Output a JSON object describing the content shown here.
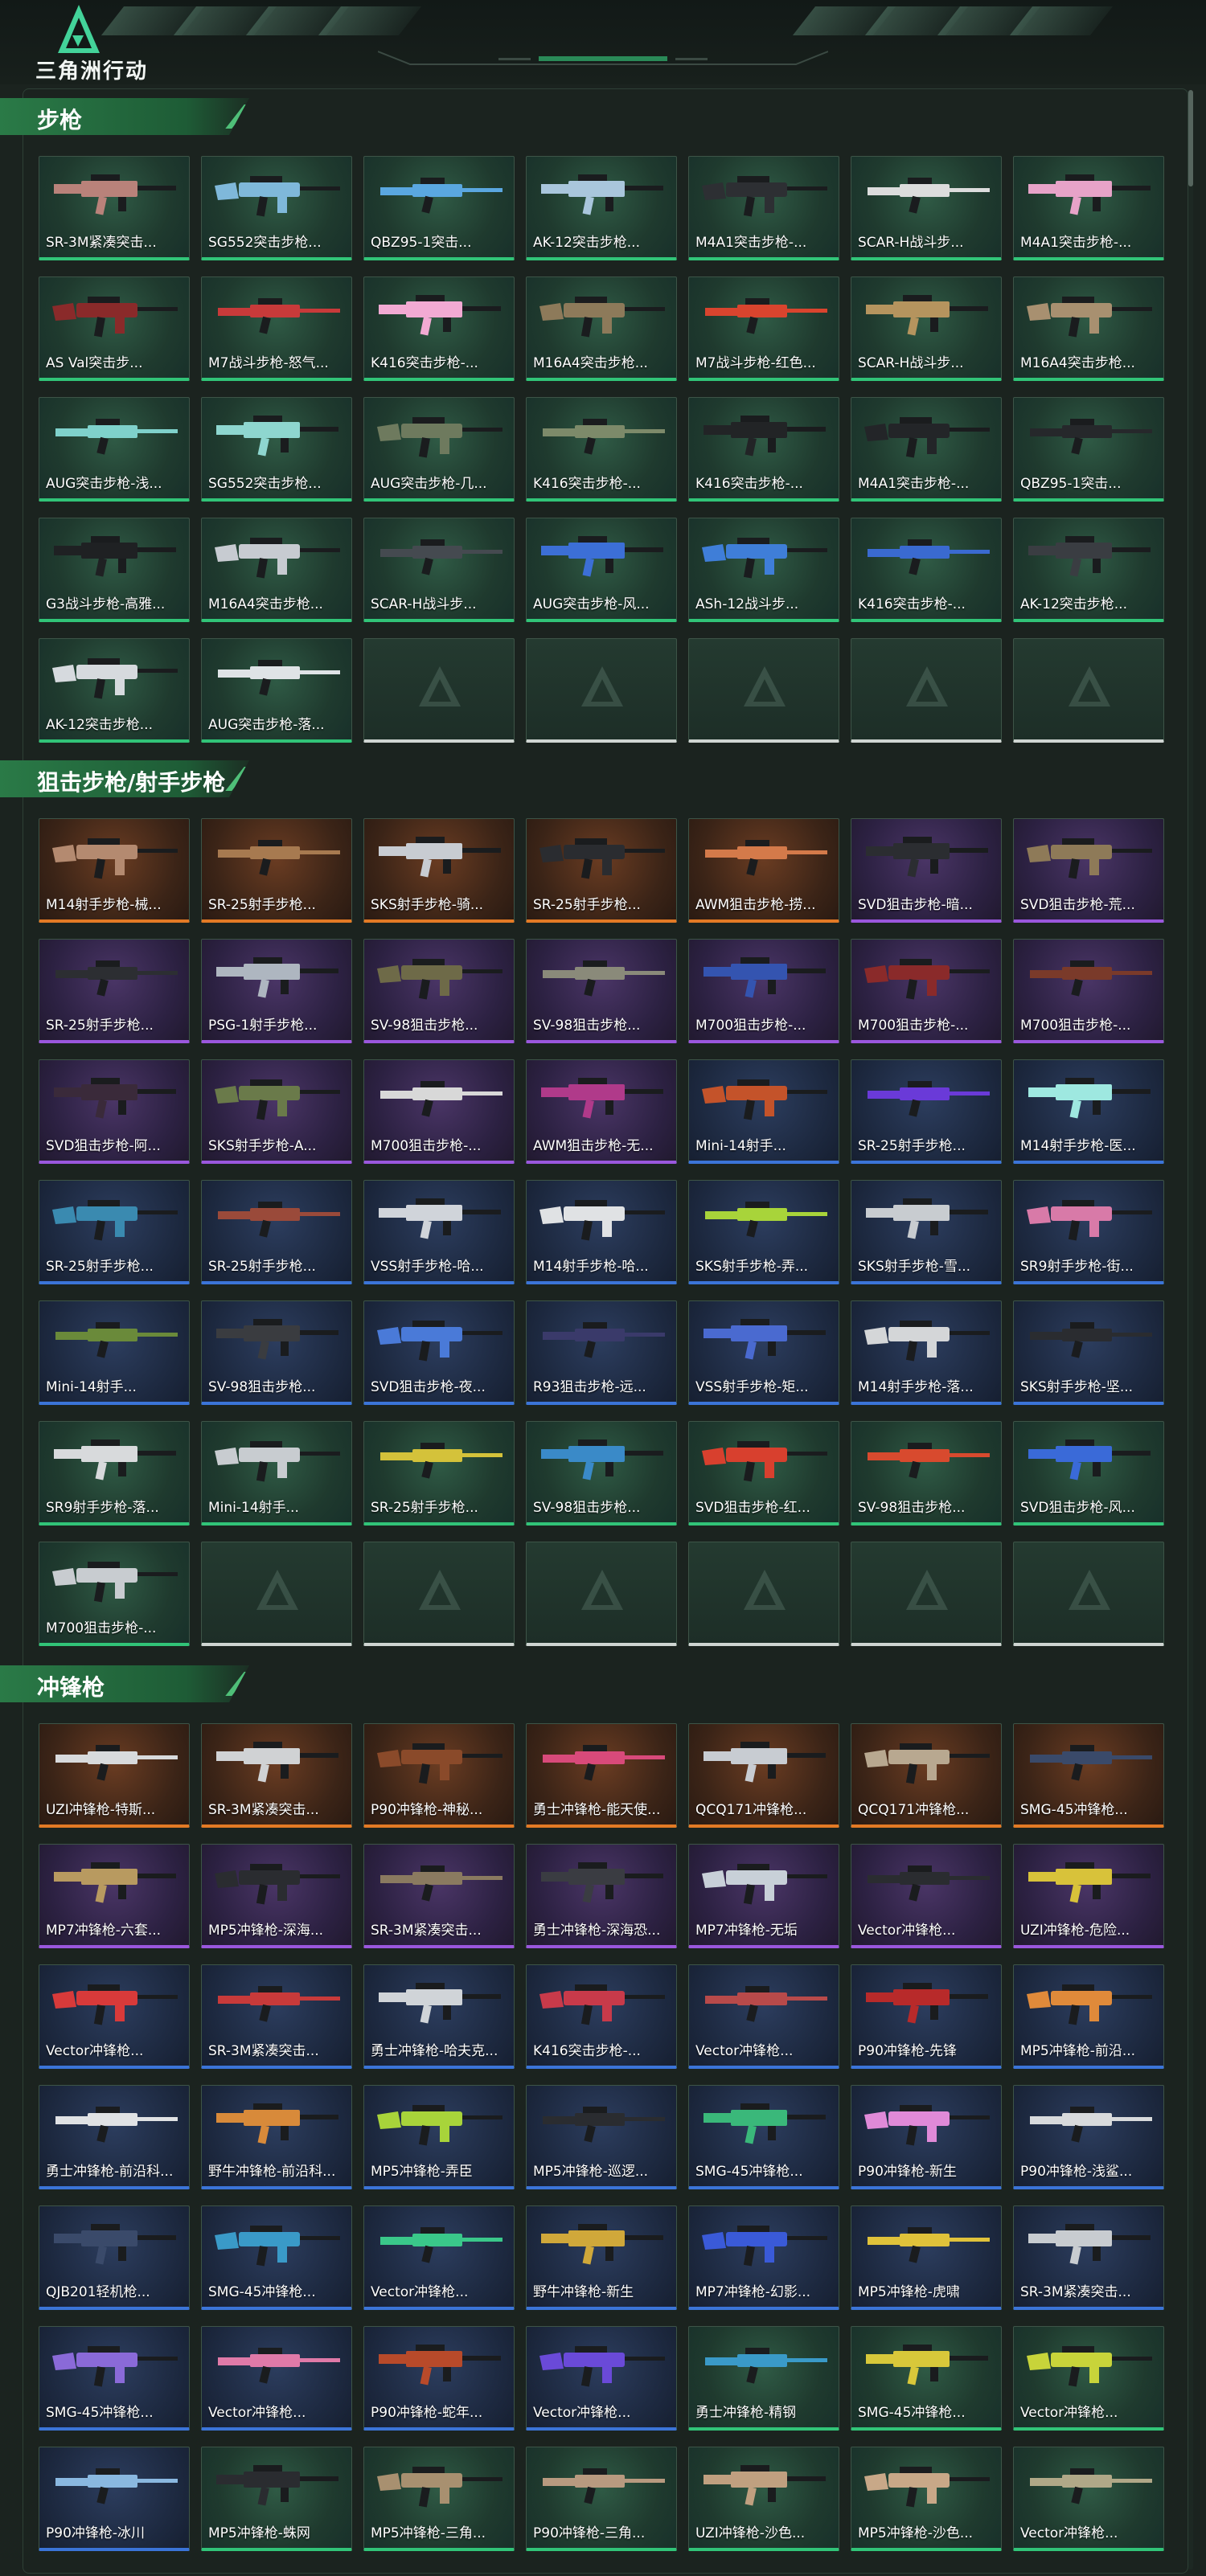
{
  "header": {
    "app_name": "三角洲行动",
    "logo_icon": "delta-triangle-icon"
  },
  "colors": {
    "accent": "#31c478",
    "rarity_green": "#31c478",
    "rarity_orange": "#e37a25",
    "rarity_purple": "#9a57dd",
    "rarity_blue": "#3b74d8",
    "empty_slot": "#cfd5d2"
  },
  "sections": [
    {
      "title": "步枪",
      "items": [
        {
          "name": "SR-3M紧凑突击...",
          "rarity": "green",
          "color": "#b9827a"
        },
        {
          "name": "SG552突击步枪...",
          "rarity": "green",
          "color": "#7fb8da"
        },
        {
          "name": "QBZ95-1突击...",
          "rarity": "green",
          "color": "#5aa7e0"
        },
        {
          "name": "AK-12突击步枪...",
          "rarity": "green",
          "color": "#a9c6dc"
        },
        {
          "name": "M4A1突击步枪-...",
          "rarity": "green",
          "color": "#2d2f33"
        },
        {
          "name": "SCAR-H战斗步...",
          "rarity": "green",
          "color": "#dcdcdc"
        },
        {
          "name": "M4A1突击步枪-...",
          "rarity": "green",
          "color": "#e7a3c8"
        },
        {
          "name": "AS Val突击步...",
          "rarity": "green",
          "color": "#8a2a2a"
        },
        {
          "name": "M7战斗步枪-怒气...",
          "rarity": "green",
          "color": "#c83a3a"
        },
        {
          "name": "K416突击步枪-...",
          "rarity": "green",
          "color": "#f2aad3"
        },
        {
          "name": "M16A4突击步枪...",
          "rarity": "green",
          "color": "#8d7a5a"
        },
        {
          "name": "M7战斗步枪-红色...",
          "rarity": "green",
          "color": "#d9442e"
        },
        {
          "name": "SCAR-H战斗步...",
          "rarity": "green",
          "color": "#b5945e"
        },
        {
          "name": "M16A4突击步枪...",
          "rarity": "green",
          "color": "#a89070"
        },
        {
          "name": "AUG突击步枪-浅...",
          "rarity": "green",
          "color": "#7fd1cb"
        },
        {
          "name": "SG552突击步枪...",
          "rarity": "green",
          "color": "#8ed6cf"
        },
        {
          "name": "AUG突击步枪-几...",
          "rarity": "green",
          "color": "#6e7a5e"
        },
        {
          "name": "K416突击步枪-...",
          "rarity": "green",
          "color": "#7d8a6a"
        },
        {
          "name": "K416突击步枪-...",
          "rarity": "green",
          "color": "#222426"
        },
        {
          "name": "M4A1突击步枪-...",
          "rarity": "green",
          "color": "#232528"
        },
        {
          "name": "QBZ95-1突击...",
          "rarity": "green",
          "color": "#26282b"
        },
        {
          "name": "G3战斗步枪-高雅...",
          "rarity": "green",
          "color": "#1f2123"
        },
        {
          "name": "M16A4突击步枪...",
          "rarity": "green",
          "color": "#c7cbd1"
        },
        {
          "name": "SCAR-H战斗步...",
          "rarity": "green",
          "color": "#454a50"
        },
        {
          "name": "AUG突击步枪-风...",
          "rarity": "green",
          "color": "#3c6fd6"
        },
        {
          "name": "ASh-12战斗步...",
          "rarity": "green",
          "color": "#3f7ed8"
        },
        {
          "name": "K416突击步枪-...",
          "rarity": "green",
          "color": "#3a6ad0"
        },
        {
          "name": "AK-12突击步枪...",
          "rarity": "green",
          "color": "#3a3d42"
        },
        {
          "name": "AK-12突击步枪...",
          "rarity": "green",
          "color": "#d6dade"
        },
        {
          "name": "AUG突击步枪-落...",
          "rarity": "green",
          "color": "#dfe3e6"
        }
      ]
    },
    {
      "title": "狙击步枪/射手步枪",
      "items": [
        {
          "name": "M14射手步枪-械...",
          "rarity": "orange",
          "color": "#b48a70"
        },
        {
          "name": "SR-25射手步枪...",
          "rarity": "orange",
          "color": "#a77a50"
        },
        {
          "name": "SKS射手步枪-骑...",
          "rarity": "orange",
          "color": "#c8ccd2"
        },
        {
          "name": "SR-25射手步枪...",
          "rarity": "orange",
          "color": "#2a2c30"
        },
        {
          "name": "AWM狙击步枪-捞...",
          "rarity": "orange",
          "color": "#d47a4a"
        },
        {
          "name": "SVD狙击步枪-暗...",
          "rarity": "purple",
          "color": "#2b2d31"
        },
        {
          "name": "SVD狙击步枪-荒...",
          "rarity": "purple",
          "color": "#8e7a58"
        },
        {
          "name": "SR-25射手步枪...",
          "rarity": "purple",
          "color": "#2c2e32"
        },
        {
          "name": "PSG-1射手步枪...",
          "rarity": "purple",
          "color": "#aeb6c0"
        },
        {
          "name": "SV-98狙击步枪...",
          "rarity": "purple",
          "color": "#6e6a48"
        },
        {
          "name": "SV-98狙击步枪...",
          "rarity": "purple",
          "color": "#8a8a7a"
        },
        {
          "name": "M700狙击步枪-...",
          "rarity": "purple",
          "color": "#3454b0"
        },
        {
          "name": "M700狙击步枪-...",
          "rarity": "purple",
          "color": "#8a2a2a"
        },
        {
          "name": "M700狙击步枪-...",
          "rarity": "purple",
          "color": "#7a3a2a"
        },
        {
          "name": "SVD狙击步枪-阿...",
          "rarity": "purple",
          "color": "#3a2a3a"
        },
        {
          "name": "SKS射手步枪-A...",
          "rarity": "purple",
          "color": "#6a7a4a"
        },
        {
          "name": "M700狙击步枪-...",
          "rarity": "purple",
          "color": "#d8d8d8"
        },
        {
          "name": "AWM狙击步枪-无...",
          "rarity": "purple",
          "color": "#b03a8a"
        },
        {
          "name": "Mini-14射手...",
          "rarity": "blue",
          "color": "#c4532a"
        },
        {
          "name": "SR-25射手步枪...",
          "rarity": "blue",
          "color": "#6a3ad8"
        },
        {
          "name": "M14射手步枪-医...",
          "rarity": "blue",
          "color": "#9ee8e0"
        },
        {
          "name": "SR-25射手步枪...",
          "rarity": "blue",
          "color": "#3a8ab0"
        },
        {
          "name": "SR-25射手步枪...",
          "rarity": "blue",
          "color": "#9a4a3a"
        },
        {
          "name": "VSS射手步枪-哈...",
          "rarity": "blue",
          "color": "#d0d4da"
        },
        {
          "name": "M14射手步枪-哈...",
          "rarity": "blue",
          "color": "#e0e2e4"
        },
        {
          "name": "SKS射手步枪-弄...",
          "rarity": "blue",
          "color": "#a8d43a"
        },
        {
          "name": "SKS射手步枪-雪...",
          "rarity": "blue",
          "color": "#c8ccd0"
        },
        {
          "name": "SR9射手步枪-街...",
          "rarity": "blue",
          "color": "#d87aa8"
        },
        {
          "name": "Mini-14射手...",
          "rarity": "blue",
          "color": "#6a8a3a"
        },
        {
          "name": "SV-98狙击步枪...",
          "rarity": "blue",
          "color": "#3a3c40"
        },
        {
          "name": "SVD狙击步枪-夜...",
          "rarity": "blue",
          "color": "#4a7ad8"
        },
        {
          "name": "R93狙击步枪-远...",
          "rarity": "blue",
          "color": "#3a3a6a"
        },
        {
          "name": "VSS射手步枪-矩...",
          "rarity": "blue",
          "color": "#4a6ad0"
        },
        {
          "name": "M14射手步枪-落...",
          "rarity": "blue",
          "color": "#d4d6d8"
        },
        {
          "name": "SKS射手步枪-坚...",
          "rarity": "blue",
          "color": "#2a2c30"
        },
        {
          "name": "SR9射手步枪-落...",
          "rarity": "green",
          "color": "#d8dadc"
        },
        {
          "name": "Mini-14射手...",
          "rarity": "green",
          "color": "#c8ccd0"
        },
        {
          "name": "SR-25射手步枪...",
          "rarity": "green",
          "color": "#d4c23a"
        },
        {
          "name": "SV-98狙击步枪...",
          "rarity": "green",
          "color": "#3a8ac8"
        },
        {
          "name": "SVD狙击步枪-红...",
          "rarity": "green",
          "color": "#d8402e"
        },
        {
          "name": "SV-98狙击步枪...",
          "rarity": "green",
          "color": "#d84a2e"
        },
        {
          "name": "SVD狙击步枪-风...",
          "rarity": "green",
          "color": "#3a6ad8"
        },
        {
          "name": "M700狙击步枪-...",
          "rarity": "green",
          "color": "#c8ccd0"
        }
      ]
    },
    {
      "title": "冲锋枪",
      "items": [
        {
          "name": "UZI冲锋枪-特斯...",
          "rarity": "orange",
          "color": "#d8dadc"
        },
        {
          "name": "SR-3M紧凑突击...",
          "rarity": "orange",
          "color": "#d0d2d4"
        },
        {
          "name": "P90冲锋枪-神秘...",
          "rarity": "orange",
          "color": "#8a4a2a"
        },
        {
          "name": "勇士冲锋枪-能天使...",
          "rarity": "orange",
          "color": "#d84a7a"
        },
        {
          "name": "QCQ171冲锋枪...",
          "rarity": "orange",
          "color": "#c8ccd2"
        },
        {
          "name": "QCQ171冲锋枪...",
          "rarity": "orange",
          "color": "#b8a890"
        },
        {
          "name": "SMG-45冲锋枪...",
          "rarity": "orange",
          "color": "#3a4a6a"
        },
        {
          "name": "MP7冲锋枪-六套...",
          "rarity": "purple",
          "color": "#b89a60"
        },
        {
          "name": "MP5冲锋枪-深海...",
          "rarity": "purple",
          "color": "#2a2c30"
        },
        {
          "name": "SR-3M紧凑突击...",
          "rarity": "purple",
          "color": "#8a7a60"
        },
        {
          "name": "勇士冲锋枪-深海恐...",
          "rarity": "purple",
          "color": "#3a3c42"
        },
        {
          "name": "MP7冲锋枪-无垢",
          "rarity": "purple",
          "color": "#c8d0d8"
        },
        {
          "name": "Vector冲锋枪...",
          "rarity": "purple",
          "color": "#2a2c30"
        },
        {
          "name": "UZI冲锋枪-危险...",
          "rarity": "purple",
          "color": "#d8c23a"
        },
        {
          "name": "Vector冲锋枪...",
          "rarity": "blue",
          "color": "#d83a3a"
        },
        {
          "name": "SR-3M紧凑突击...",
          "rarity": "blue",
          "color": "#c83a3a"
        },
        {
          "name": "勇士冲锋枪-哈夫克...",
          "rarity": "blue",
          "color": "#d0d4d8"
        },
        {
          "name": "K416突击步枪-...",
          "rarity": "blue",
          "color": "#c83a4a"
        },
        {
          "name": "Vector冲锋枪...",
          "rarity": "blue",
          "color": "#b84a4a"
        },
        {
          "name": "P90冲锋枪-先锋",
          "rarity": "blue",
          "color": "#b82a2a"
        },
        {
          "name": "MP5冲锋枪-前沿...",
          "rarity": "blue",
          "color": "#e08a3a"
        },
        {
          "name": "勇士冲锋枪-前沿科...",
          "rarity": "blue",
          "color": "#e0e2e4"
        },
        {
          "name": "野牛冲锋枪-前沿科...",
          "rarity": "blue",
          "color": "#d88a3a"
        },
        {
          "name": "MP5冲锋枪-弄臣",
          "rarity": "blue",
          "color": "#a8d43a"
        },
        {
          "name": "MP5冲锋枪-巡逻...",
          "rarity": "blue",
          "color": "#2a2c30"
        },
        {
          "name": "SMG-45冲锋枪...",
          "rarity": "blue",
          "color": "#3ab87a"
        },
        {
          "name": "P90冲锋枪-新生",
          "rarity": "blue",
          "color": "#e08ad8"
        },
        {
          "name": "P90冲锋枪-浅鲨...",
          "rarity": "blue",
          "color": "#d8dadc"
        },
        {
          "name": "QJB201轻机枪...",
          "rarity": "blue",
          "color": "#3a4a6a"
        },
        {
          "name": "SMG-45冲锋枪...",
          "rarity": "blue",
          "color": "#3a9ac8"
        },
        {
          "name": "Vector冲锋枪...",
          "rarity": "blue",
          "color": "#3ac88a"
        },
        {
          "name": "野牛冲锋枪-新生",
          "rarity": "blue",
          "color": "#d0a83a"
        },
        {
          "name": "MP7冲锋枪-幻影...",
          "rarity": "blue",
          "color": "#3a5ad8"
        },
        {
          "name": "MP5冲锋枪-虎啸",
          "rarity": "blue",
          "color": "#e0c23a"
        },
        {
          "name": "SR-3M紧凑突击...",
          "rarity": "blue",
          "color": "#c8ccd0"
        },
        {
          "name": "SMG-45冲锋枪...",
          "rarity": "blue",
          "color": "#8a6ad8"
        },
        {
          "name": "Vector冲锋枪...",
          "rarity": "blue",
          "color": "#e07aa8"
        },
        {
          "name": "P90冲锋枪-蛇年...",
          "rarity": "blue",
          "color": "#b84a2a"
        },
        {
          "name": "Vector冲锋枪...",
          "rarity": "blue",
          "color": "#6a4ad8"
        },
        {
          "name": "勇士冲锋枪-精钢",
          "rarity": "green",
          "color": "#3a9ac8"
        },
        {
          "name": "SMG-45冲锋枪...",
          "rarity": "green",
          "color": "#d8c83a"
        },
        {
          "name": "Vector冲锋枪...",
          "rarity": "green",
          "color": "#c8d43a"
        },
        {
          "name": "P90冲锋枪-冰川",
          "rarity": "blue",
          "color": "#8ab8e0"
        },
        {
          "name": "MP5冲锋枪-蛛网",
          "rarity": "green",
          "color": "#2a2c30"
        },
        {
          "name": "MP5冲锋枪-三角...",
          "rarity": "green",
          "color": "#a89070"
        },
        {
          "name": "P90冲锋枪-三角...",
          "rarity": "green",
          "color": "#b89a80"
        },
        {
          "name": "UZI冲锋枪-沙色...",
          "rarity": "green",
          "color": "#c0a080"
        },
        {
          "name": "MP5冲锋枪-沙色...",
          "rarity": "green",
          "color": "#c8a888"
        },
        {
          "name": "Vector冲锋枪...",
          "rarity": "green",
          "color": "#b0a888"
        }
      ]
    }
  ]
}
